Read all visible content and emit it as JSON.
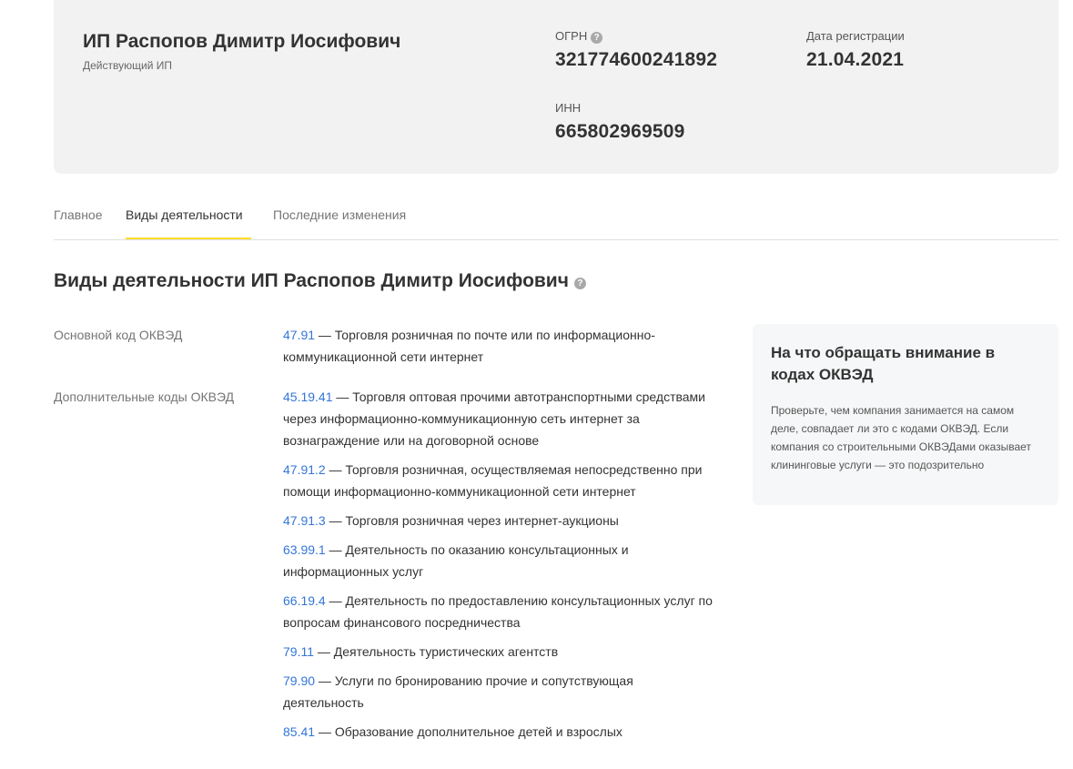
{
  "company": {
    "name": "ИП Распопов Димитр Иосифович",
    "status": "Действующий ИП",
    "ogrn_label": "ОГРН",
    "ogrn_value": "321774600241892",
    "inn_label": "ИНН",
    "inn_value": "665802969509",
    "reg_date_label": "Дата регистрации",
    "reg_date_value": "21.04.2021"
  },
  "tabs": [
    {
      "label": "Главное"
    },
    {
      "label": "Виды деятельности",
      "active": true
    },
    {
      "label": "Последние изменения"
    }
  ],
  "section": {
    "title": "Виды деятельности ИП Распопов Димитр Иосифович",
    "main_label": "Основной код ОКВЭД",
    "additional_label": "Дополнительные коды ОКВЭД"
  },
  "main_code": {
    "code": "47.91",
    "text": " — Торговля розничная по почте или по информационно-коммуникационной сети интернет"
  },
  "additional_codes": [
    {
      "code": "45.19.41",
      "text": " — Торговля оптовая прочими автотранспортными средствами через информационно-коммуникационную сеть интернет за вознаграждение или на договорной основе"
    },
    {
      "code": "47.91.2",
      "text": " — Торговля розничная, осуществляемая непосредственно при помощи информационно-коммуникационной сети интернет"
    },
    {
      "code": "47.91.3",
      "text": " — Торговля розничная через интернет-аукционы"
    },
    {
      "code": "63.99.1",
      "text": " — Деятельность по оказанию консультационных и информационных услуг"
    },
    {
      "code": "66.19.4",
      "text": " — Деятельность по предоставлению консультационных услуг по вопросам финансового посредничества"
    },
    {
      "code": "79.11",
      "text": " — Деятельность туристических агентств"
    },
    {
      "code": "79.90",
      "text": " — Услуги по бронированию прочие и сопутствующая деятельность"
    },
    {
      "code": "85.41",
      "text": " — Образование дополнительное детей и взрослых"
    }
  ],
  "tip": {
    "title": "На что обращать внимание в кодах ОКВЭД",
    "text": "Проверьте, чем компания занимается на самом деле, совпадает ли это с кодами ОКВЭД. Если компания со строительными ОКВЭДами оказывает клининговые услуги — это подозрительно"
  },
  "icons": {
    "help": "question-circle-icon"
  },
  "colors": {
    "accent": "#ffdd2d",
    "link": "#3476d8",
    "card_bg": "#f2f2f2"
  }
}
